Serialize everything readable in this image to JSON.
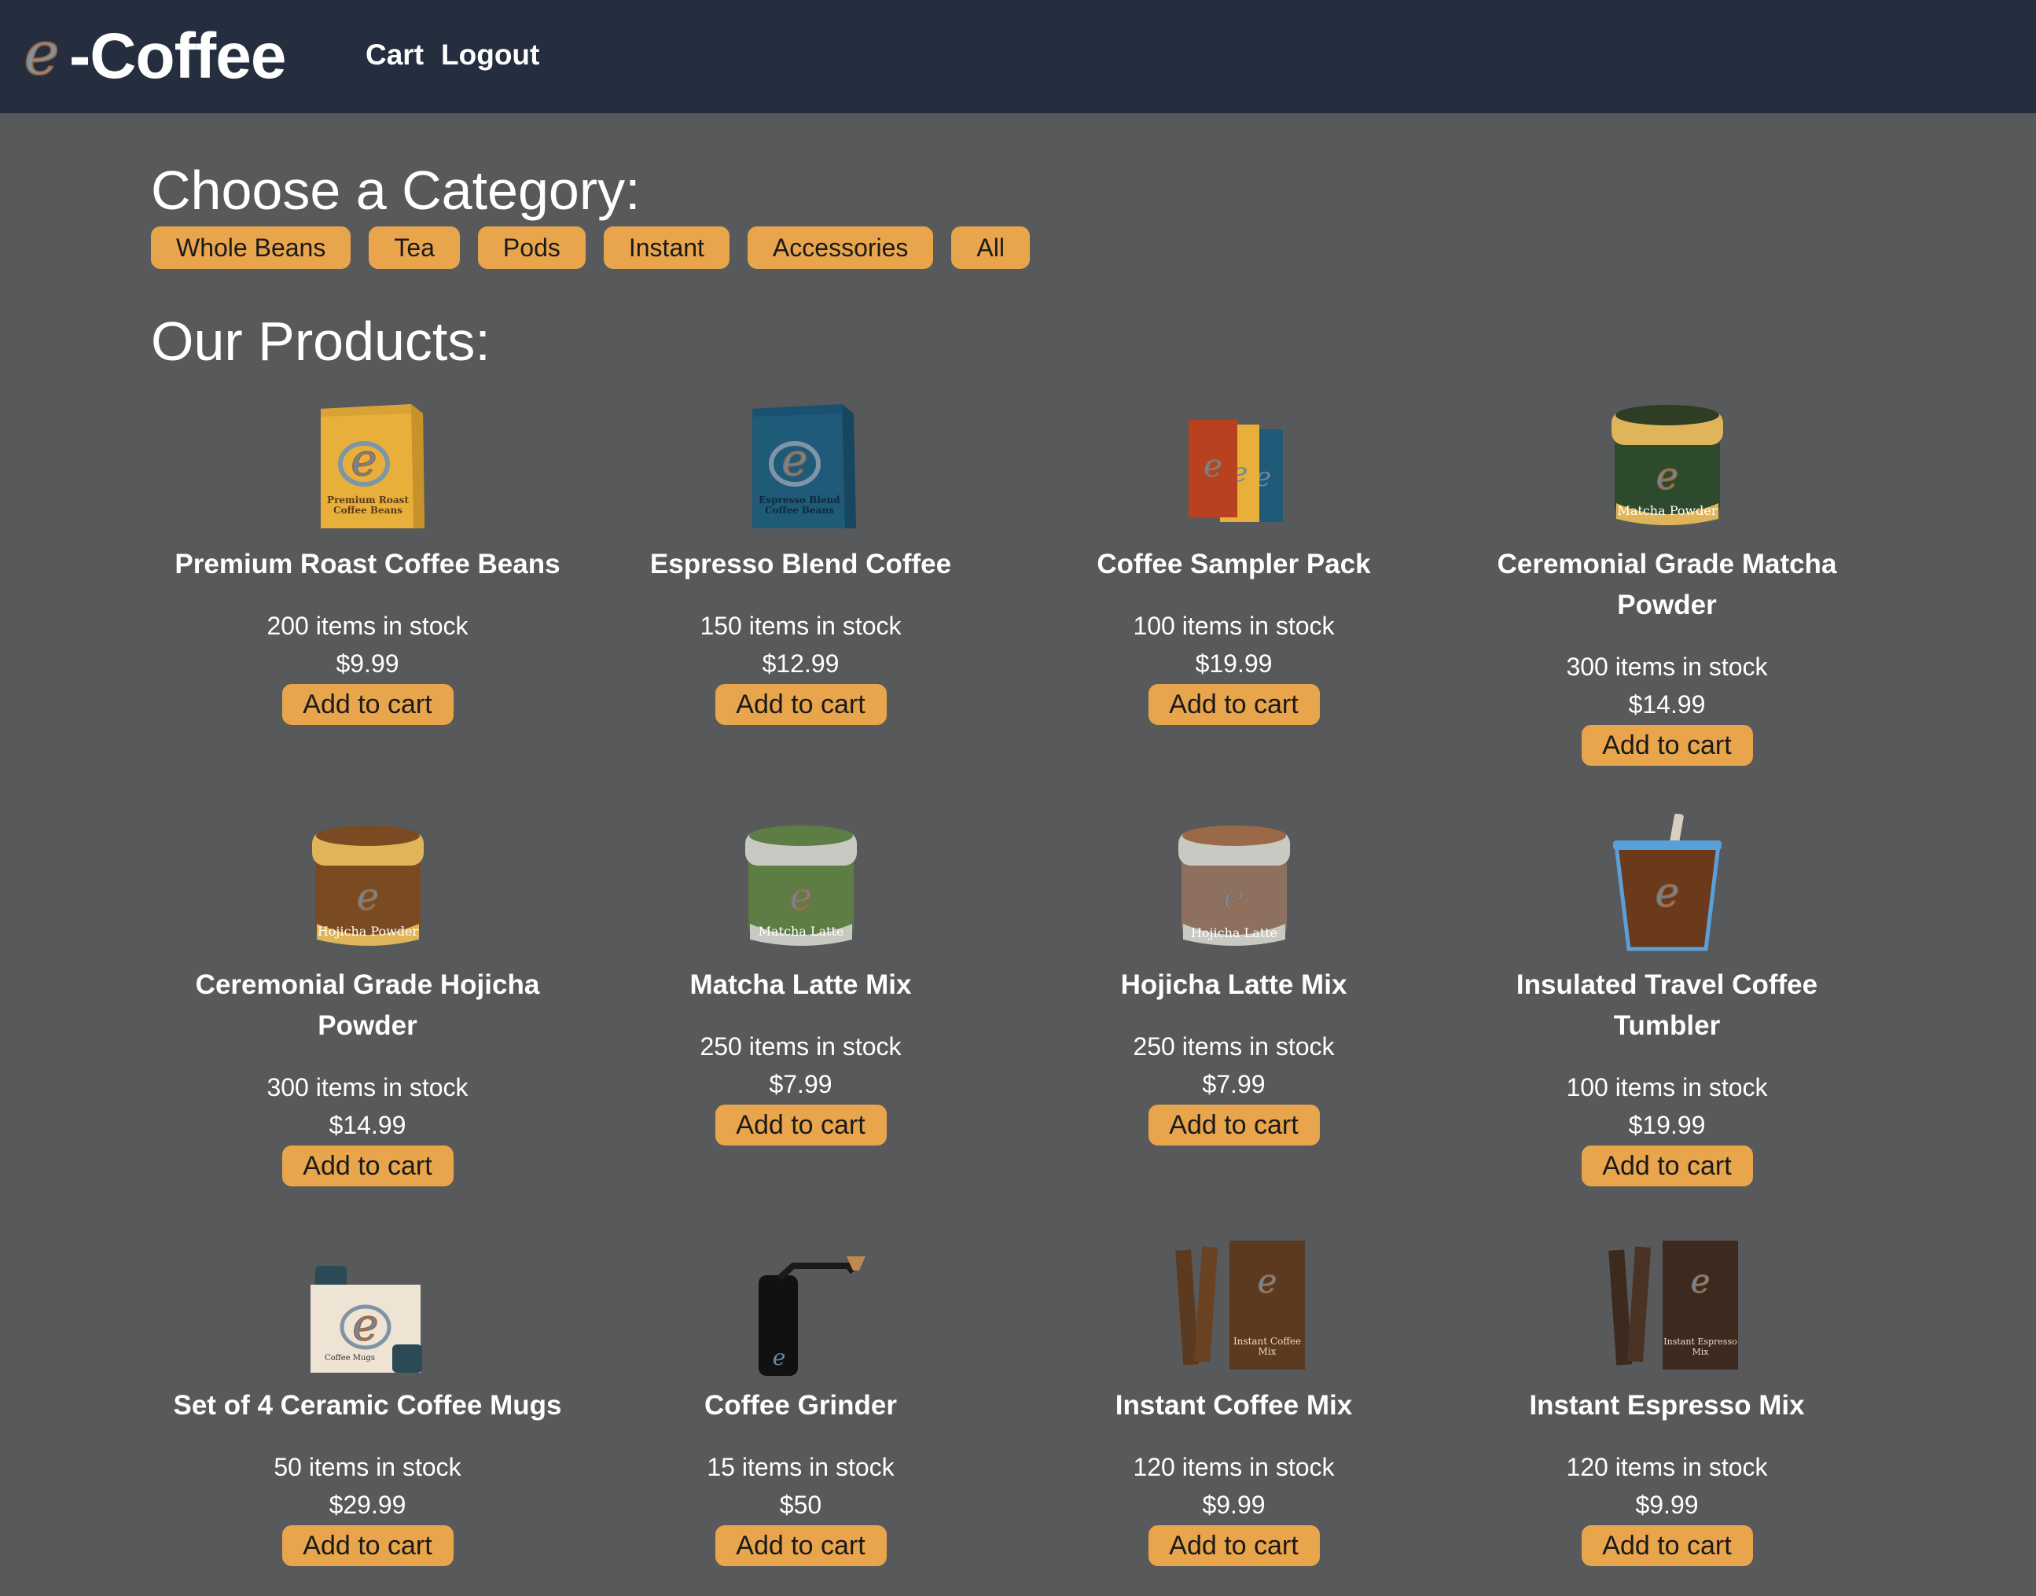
{
  "header": {
    "brand_text": "-Coffee",
    "brand_mark_letter": "e",
    "nav": [
      {
        "label": "Cart"
      },
      {
        "label": "Logout"
      }
    ]
  },
  "categories": {
    "heading": "Choose a Category:",
    "items": [
      {
        "label": "Whole Beans"
      },
      {
        "label": "Tea"
      },
      {
        "label": "Pods"
      },
      {
        "label": "Instant"
      },
      {
        "label": "Accessories"
      },
      {
        "label": "All"
      }
    ]
  },
  "products": {
    "heading": "Our Products:",
    "button_label": "Add to cart",
    "items": [
      {
        "name": "Premium Roast Coffee Beans",
        "stock": "200 items in stock",
        "price": "$9.99",
        "image": "coffee-bag-icon",
        "package_text": "Premium Roast Coffee Beans",
        "color": "#e8b03a"
      },
      {
        "name": "Espresso Blend Coffee",
        "stock": "150 items in stock",
        "price": "$12.99",
        "image": "coffee-bag-icon",
        "package_text": "Espresso Blend Coffee Beans",
        "color": "#1f5a78"
      },
      {
        "name": "Coffee Sampler Pack",
        "stock": "100 items in stock",
        "price": "$19.99",
        "image": "sampler-pack-icon",
        "package_text": "",
        "color": "#b8421f"
      },
      {
        "name": "Ceremonial Grade Matcha Powder",
        "stock": "300 items in stock",
        "price": "$14.99",
        "image": "jar-icon",
        "package_text": "Matcha Powder",
        "color": "#2e4a2c"
      },
      {
        "name": "Ceremonial Grade Hojicha Powder",
        "stock": "300 items in stock",
        "price": "$14.99",
        "image": "jar-icon",
        "package_text": "Hojicha Powder",
        "color": "#7a4a22"
      },
      {
        "name": "Matcha Latte Mix",
        "stock": "250 items in stock",
        "price": "$7.99",
        "image": "jar-icon",
        "package_text": "Matcha Latte",
        "color": "#5d7d45"
      },
      {
        "name": "Hojicha Latte Mix",
        "stock": "250 items in stock",
        "price": "$7.99",
        "image": "jar-icon",
        "package_text": "Hojicha Latte",
        "color": "#8e7060"
      },
      {
        "name": "Insulated Travel Coffee Tumbler",
        "stock": "100 items in stock",
        "price": "$19.99",
        "image": "tumbler-icon",
        "package_text": "",
        "color": "#6b3a1a"
      },
      {
        "name": "Set of 4 Ceramic Coffee Mugs",
        "stock": "50 items in stock",
        "price": "$29.99",
        "image": "mug-set-icon",
        "package_text": "Coffee Mugs",
        "color": "#efe3d3"
      },
      {
        "name": "Coffee Grinder",
        "stock": "15 items in stock",
        "price": "$50",
        "image": "grinder-icon",
        "package_text": "",
        "color": "#111111"
      },
      {
        "name": "Instant Coffee Mix",
        "stock": "120 items in stock",
        "price": "$9.99",
        "image": "instant-box-icon",
        "package_text": "Instant Coffee Mix",
        "color": "#5c3a1f"
      },
      {
        "name": "Instant Espresso Mix",
        "stock": "120 items in stock",
        "price": "$9.99",
        "image": "instant-box-icon",
        "package_text": "Instant Espresso Mix",
        "color": "#3d2a1f"
      }
    ]
  }
}
